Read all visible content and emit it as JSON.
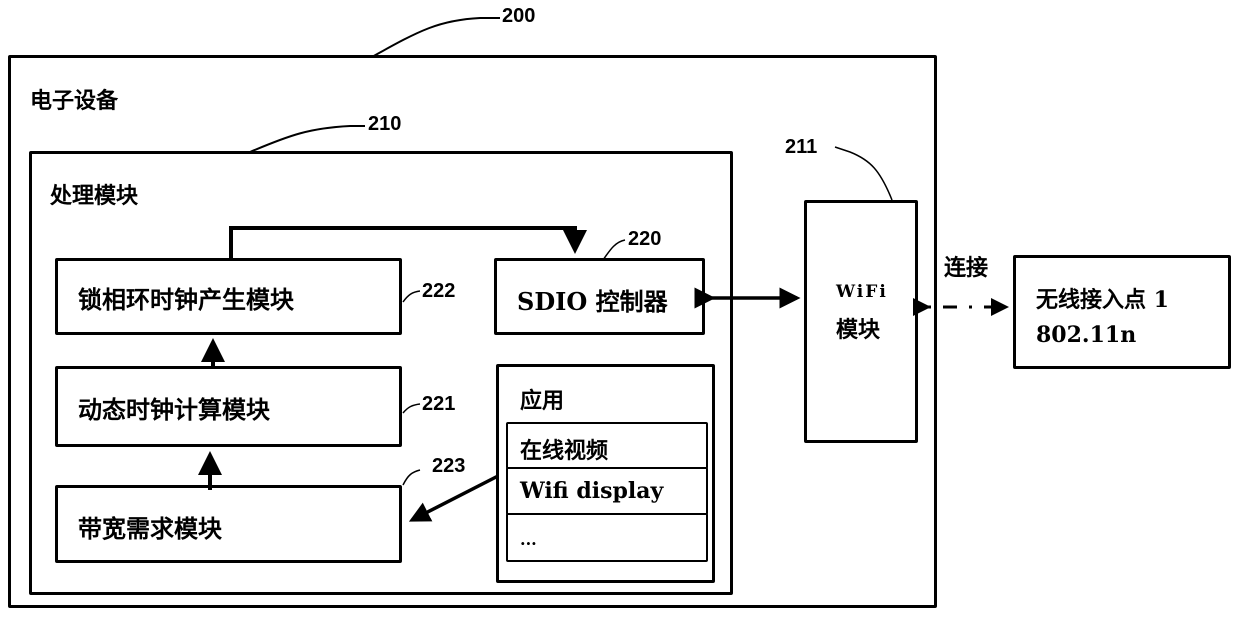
{
  "diagram": {
    "device": {
      "label": "电子设备",
      "ref": "200"
    },
    "processing_module": {
      "label": "处理模块",
      "ref": "210"
    },
    "pll_clock_module": {
      "label": "锁相环时钟产生模块",
      "ref": "222"
    },
    "dynamic_clock_module": {
      "label": "动态时钟计算模块",
      "ref": "221"
    },
    "bandwidth_module": {
      "label": "带宽需求模块",
      "ref": "223"
    },
    "sdio_controller": {
      "label": "SDIO 控制器",
      "ref": "220"
    },
    "applications": {
      "label": "应用",
      "items": [
        "在线视频",
        "Wifi display",
        "..."
      ]
    },
    "wifi_module": {
      "line1": "WiFi",
      "line2": "模块",
      "ref": "211"
    },
    "connection_label": "连接",
    "access_point": {
      "line1": "无线接入点 1",
      "line2": "802.11n"
    }
  }
}
